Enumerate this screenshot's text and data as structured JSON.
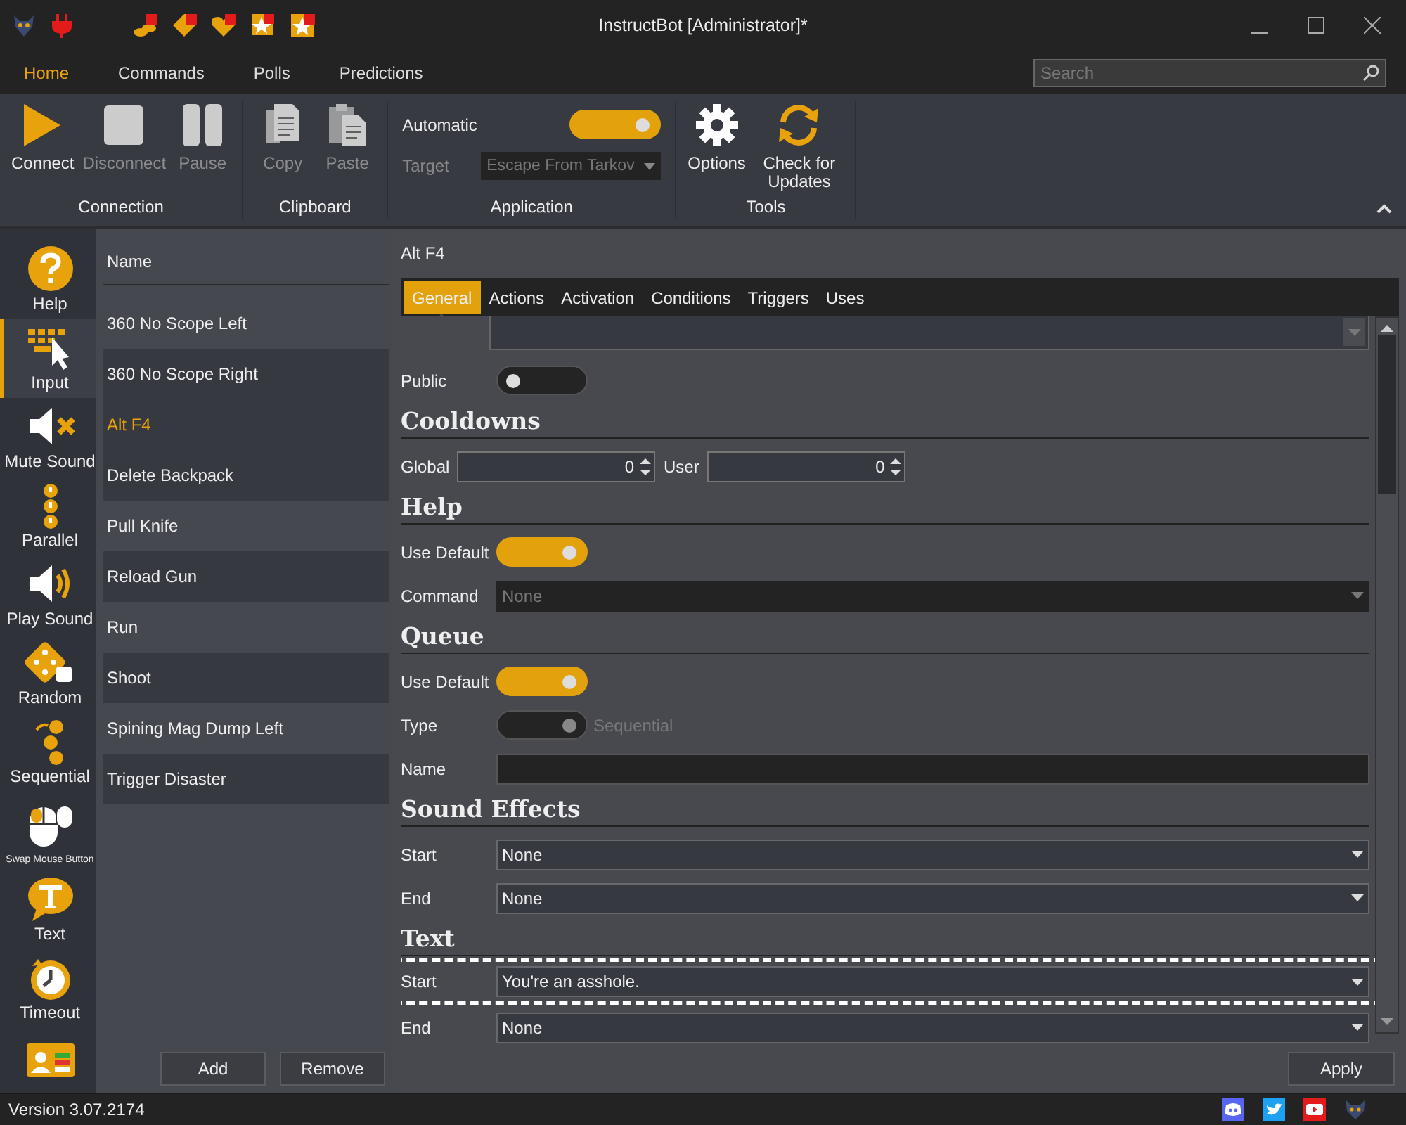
{
  "window": {
    "title": "InstructBot [Administrator]*"
  },
  "menu_tabs": [
    {
      "label": "Home",
      "selected": true
    },
    {
      "label": "Commands",
      "selected": false
    },
    {
      "label": "Polls",
      "selected": false
    },
    {
      "label": "Predictions",
      "selected": false
    }
  ],
  "search": {
    "placeholder": "Search"
  },
  "ribbon": {
    "groups": [
      {
        "kind": "buttons",
        "label": "Connection",
        "items": [
          {
            "label": "Connect",
            "disabled": false
          },
          {
            "label": "Disconnect",
            "disabled": true
          },
          {
            "label": "Pause",
            "disabled": true
          }
        ]
      },
      {
        "kind": "buttons",
        "label": "Clipboard",
        "items": [
          {
            "label": "Copy",
            "disabled": true
          },
          {
            "label": "Paste",
            "disabled": true
          }
        ]
      },
      {
        "kind": "application",
        "label": "Application",
        "automatic": {
          "label": "Automatic",
          "on": true
        },
        "target": {
          "label": "Target",
          "value": "Escape From Tarkov",
          "disabled": true
        }
      },
      {
        "kind": "buttons",
        "label": "Tools",
        "items": [
          {
            "label": "Options",
            "disabled": false
          },
          {
            "label": "Check for Updates",
            "disabled": false
          }
        ]
      }
    ]
  },
  "sidebar": {
    "items": [
      {
        "label": "Help",
        "selected": false
      },
      {
        "label": "Input",
        "selected": true
      },
      {
        "label": "Mute Sound",
        "selected": false
      },
      {
        "label": "Parallel",
        "selected": false
      },
      {
        "label": "Play Sound",
        "selected": false
      },
      {
        "label": "Random",
        "selected": false
      },
      {
        "label": "Sequential",
        "selected": false
      },
      {
        "label": "Swap Mouse Button",
        "selected": false,
        "small": true
      },
      {
        "label": "Text",
        "selected": false
      },
      {
        "label": "Timeout",
        "selected": false
      },
      {
        "selected": false
      }
    ]
  },
  "command_list": {
    "header": "Name",
    "items": [
      {
        "label": "360 No Scope Left",
        "selected": false
      },
      {
        "label": "360 No Scope Right",
        "selected": false
      },
      {
        "label": "Alt F4",
        "selected": true
      },
      {
        "label": "Delete Backpack",
        "selected": false
      },
      {
        "label": "Pull Knife",
        "selected": false
      },
      {
        "label": "Reload Gun",
        "selected": false
      },
      {
        "label": "Run",
        "selected": false
      },
      {
        "label": "Shoot",
        "selected": false
      },
      {
        "label": "Spining Mag Dump Left",
        "selected": false
      },
      {
        "label": "Trigger Disaster",
        "selected": false
      }
    ],
    "buttons": [
      "Add",
      "Remove"
    ]
  },
  "detail": {
    "title": "Alt F4",
    "tabs": [
      {
        "label": "General",
        "selected": true
      },
      {
        "label": "Actions",
        "selected": false
      },
      {
        "label": "Activation",
        "selected": false
      },
      {
        "label": "Conditions",
        "selected": false
      },
      {
        "label": "Triggers",
        "selected": false
      },
      {
        "label": "Uses",
        "selected": false
      }
    ],
    "rows": [
      {
        "kind": "textarea"
      },
      {
        "kind": "toggle",
        "label": "Public",
        "on": false,
        "disabled": false
      },
      {
        "kind": "heading",
        "label": "Cooldowns"
      },
      {
        "kind": "spinners",
        "items": [
          {
            "label": "Global",
            "value": "0"
          },
          {
            "label": "User",
            "value": "0"
          }
        ]
      },
      {
        "kind": "heading",
        "label": "Help"
      },
      {
        "kind": "toggle",
        "label": "Use Default",
        "on": true,
        "disabled": false
      },
      {
        "kind": "dropdown",
        "label": "Command",
        "value": "None",
        "disabled": true
      },
      {
        "kind": "heading",
        "label": "Queue"
      },
      {
        "kind": "toggle",
        "label": "Use Default",
        "on": true,
        "disabled": false
      },
      {
        "kind": "toggle",
        "label": "Type",
        "on": true,
        "disabled": true,
        "text": "Sequential"
      },
      {
        "kind": "field",
        "label": "Name"
      },
      {
        "kind": "heading",
        "label": "Sound Effects"
      },
      {
        "kind": "dropdown",
        "label": "Start",
        "value": "None",
        "disabled": false
      },
      {
        "kind": "dropdown",
        "label": "End",
        "value": "None",
        "disabled": false
      },
      {
        "kind": "heading",
        "label": "Text"
      },
      {
        "kind": "dropdown",
        "label": "Start",
        "value": "You're an asshole.",
        "disabled": false,
        "highlighted": true
      },
      {
        "kind": "dropdown",
        "label": "End",
        "value": "None",
        "disabled": false
      }
    ],
    "apply": "Apply"
  },
  "status_bar": {
    "version": "Version 3.07.2174"
  }
}
